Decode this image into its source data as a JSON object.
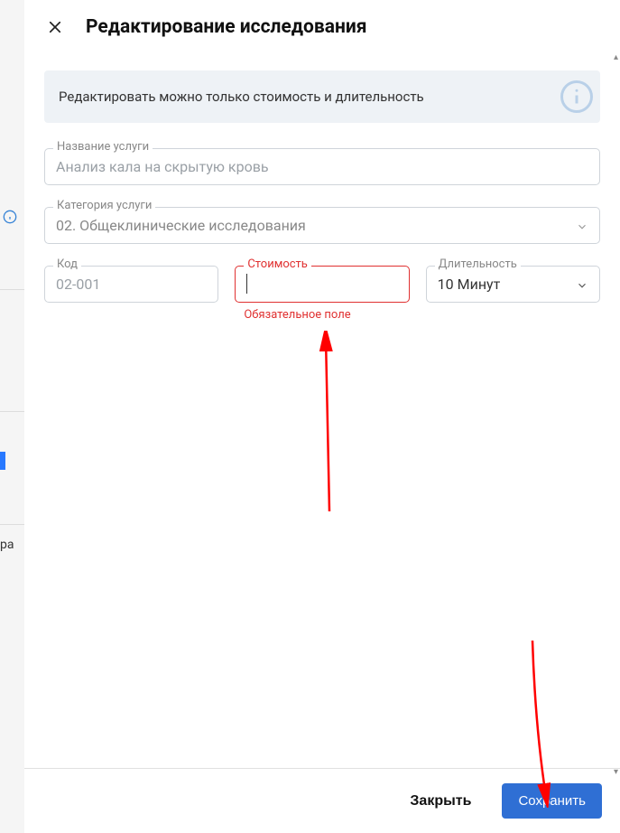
{
  "header": {
    "title": "Редактирование исследования"
  },
  "banner": {
    "text": "Редактировать можно только стоимость и длительность"
  },
  "fields": {
    "service_name": {
      "label": "Название услуги",
      "value": "Анализ кала на скрытую кровь"
    },
    "service_category": {
      "label": "Категория услуги",
      "value": "02. Общеклинические исследования"
    },
    "code": {
      "label": "Код",
      "value": "02-001"
    },
    "cost": {
      "label": "Стоимость",
      "value": "",
      "error": "Обязательное поле"
    },
    "duration": {
      "label": "Длительность",
      "value": "10 Минут"
    }
  },
  "footer": {
    "close_label": "Закрыть",
    "save_label": "Сохранить"
  },
  "background": {
    "partial_text": "ра"
  }
}
